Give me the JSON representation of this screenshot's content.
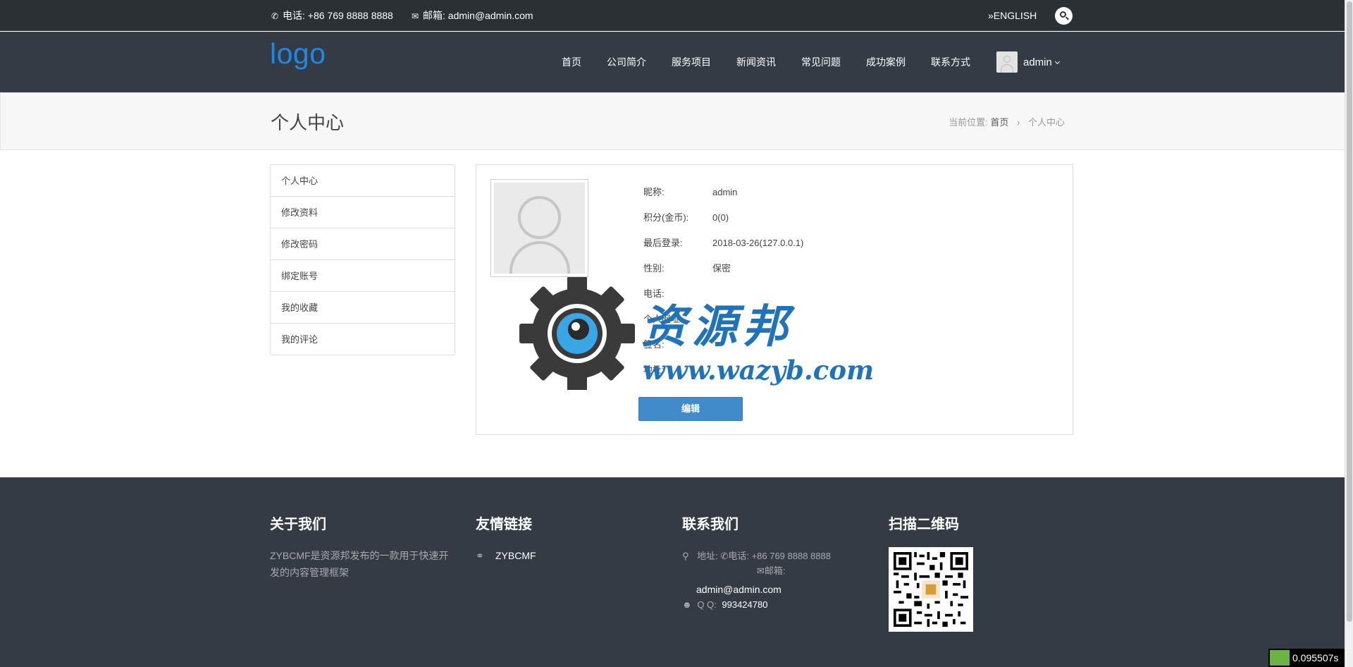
{
  "topbar": {
    "phone": "电话: +86 769 8888 8888",
    "email": "邮箱: admin@admin.com",
    "language": "ENGLISH"
  },
  "header": {
    "logo": "logo",
    "nav": [
      "首页",
      "公司简介",
      "服务项目",
      "新闻资讯",
      "常见问题",
      "成功案例",
      "联系方式"
    ],
    "user": "admin"
  },
  "banner": {
    "title": "个人中心",
    "crumb_label": "当前位置:",
    "crumb_home": "首页",
    "crumb_sep": "›",
    "crumb_current": "个人中心"
  },
  "sidebar": {
    "items": [
      "个人中心",
      "修改资料",
      "修改密码",
      "绑定账号",
      "我的收藏",
      "我的评论"
    ]
  },
  "profile": {
    "rows": [
      {
        "k": "昵称:",
        "v": "admin"
      },
      {
        "k": "积分(金币):",
        "v": "0(0)"
      },
      {
        "k": "最后登录:",
        "v": "2018-03-26(127.0.0.1)"
      },
      {
        "k": "性别:",
        "v": "保密"
      },
      {
        "k": "电话:",
        "v": ""
      },
      {
        "k": "个人网址:",
        "v": ""
      },
      {
        "k": "签名:",
        "v": ""
      },
      {
        "k": "地址:",
        "v": ""
      }
    ],
    "edit_label": "编辑"
  },
  "watermark": {
    "text": "资源邦",
    "url": "www.wazyb.com"
  },
  "footer": {
    "about_title": "关于我们",
    "about_text": "ZYBCMF是资源邦发布的一款用于快速开发的内容管理框架",
    "links_title": "友情链接",
    "link": "ZYBCMF",
    "contact_title": "联系我们",
    "contact_addr": "地址:",
    "contact_phone_label": "电话:",
    "contact_phone": "+86 769 8888 8888",
    "contact_email_label": "邮箱:",
    "contact_email": "admin@admin.com",
    "contact_qq_label": "Q Q:",
    "contact_qq": "993424780",
    "qr_title": "扫描二维码"
  },
  "timer": "0.095507s",
  "colors": {
    "topbar": "#2b3035",
    "header": "#353b44",
    "logo": "#1e88e5",
    "button": "#428bca",
    "watermark": "#2173b9"
  }
}
